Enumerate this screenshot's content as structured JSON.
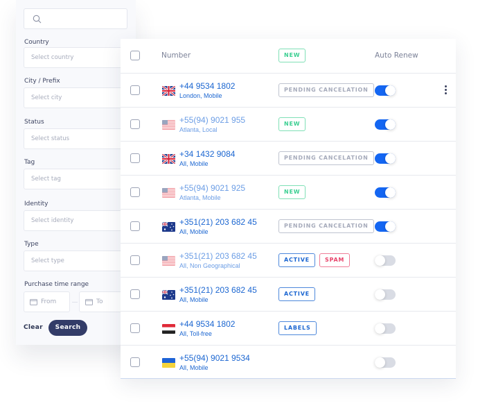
{
  "filters": {
    "search": {
      "placeholder": "",
      "value": ""
    },
    "country": {
      "label": "Country",
      "placeholder": "Select country"
    },
    "city": {
      "label": "City / Prefix",
      "placeholder": "Select city"
    },
    "status": {
      "label": "Status",
      "placeholder": "Select status"
    },
    "tag": {
      "label": "Tag",
      "placeholder": "Select tag"
    },
    "identity": {
      "label": "Identity",
      "placeholder": "Select identity"
    },
    "type": {
      "label": "Type",
      "placeholder": "Select type"
    },
    "purchase_range": {
      "label": "Purchase time range",
      "from": "From",
      "to": "To"
    },
    "clear_label": "Clear",
    "search_label": "Search"
  },
  "table": {
    "header": {
      "number": "Number",
      "badge": "NEW",
      "auto_renew": "Auto Renew"
    },
    "rows": [
      {
        "flag": "uk",
        "number": "+44 9534 1802",
        "location": "London, Mobile",
        "faded": false,
        "badges": [
          {
            "label": "PENDING CANCELATION",
            "kind": "pending"
          }
        ],
        "auto_renew": true,
        "menu": true
      },
      {
        "flag": "us",
        "number": "+55(94) 9021 955",
        "location": "Atlanta, Local",
        "faded": true,
        "badges": [
          {
            "label": "NEW",
            "kind": "new"
          }
        ],
        "auto_renew": true,
        "menu": false
      },
      {
        "flag": "uk",
        "number": "+34 1432 9084",
        "location": "All, Mobile",
        "faded": false,
        "badges": [
          {
            "label": "PENDING CANCELATION",
            "kind": "pending"
          }
        ],
        "auto_renew": true,
        "menu": false
      },
      {
        "flag": "us",
        "number": "+55(94) 9021 925",
        "location": "Atlanta, Mobile",
        "faded": true,
        "badges": [
          {
            "label": "NEW",
            "kind": "new"
          }
        ],
        "auto_renew": true,
        "menu": false
      },
      {
        "flag": "au",
        "number": "+351(21) 203 682 45",
        "location": "All, Mobile",
        "faded": false,
        "badges": [
          {
            "label": "PENDING CANCELATION",
            "kind": "pending"
          }
        ],
        "auto_renew": true,
        "menu": false
      },
      {
        "flag": "us",
        "number": "+351(21) 203 682 45",
        "location": "All, Non Geographical",
        "faded": true,
        "badges": [
          {
            "label": "ACTIVE",
            "kind": "active"
          },
          {
            "label": "SPAM",
            "kind": "spam"
          }
        ],
        "auto_renew": false,
        "menu": false
      },
      {
        "flag": "au",
        "number": "+351(21) 203 682 45",
        "location": "All, Mobile",
        "faded": false,
        "badges": [
          {
            "label": "ACTIVE",
            "kind": "active"
          }
        ],
        "auto_renew": false,
        "menu": false
      },
      {
        "flag": "ye",
        "number": "+44 9534 1802",
        "location": "All, Toll-free",
        "faded": false,
        "badges": [
          {
            "label": "LABELS",
            "kind": "labels"
          }
        ],
        "auto_renew": false,
        "menu": false
      },
      {
        "flag": "ua",
        "number": "+55(94) 9021 9534",
        "location": "All, Mobile",
        "faded": false,
        "badges": [],
        "auto_renew": false,
        "menu": false
      }
    ]
  },
  "colors": {
    "primary_blue": "#1466f2",
    "link_blue": "#1b66d1",
    "badge_new": "#3ccf92",
    "badge_spam": "#e8436a",
    "search_button": "#333c68"
  }
}
